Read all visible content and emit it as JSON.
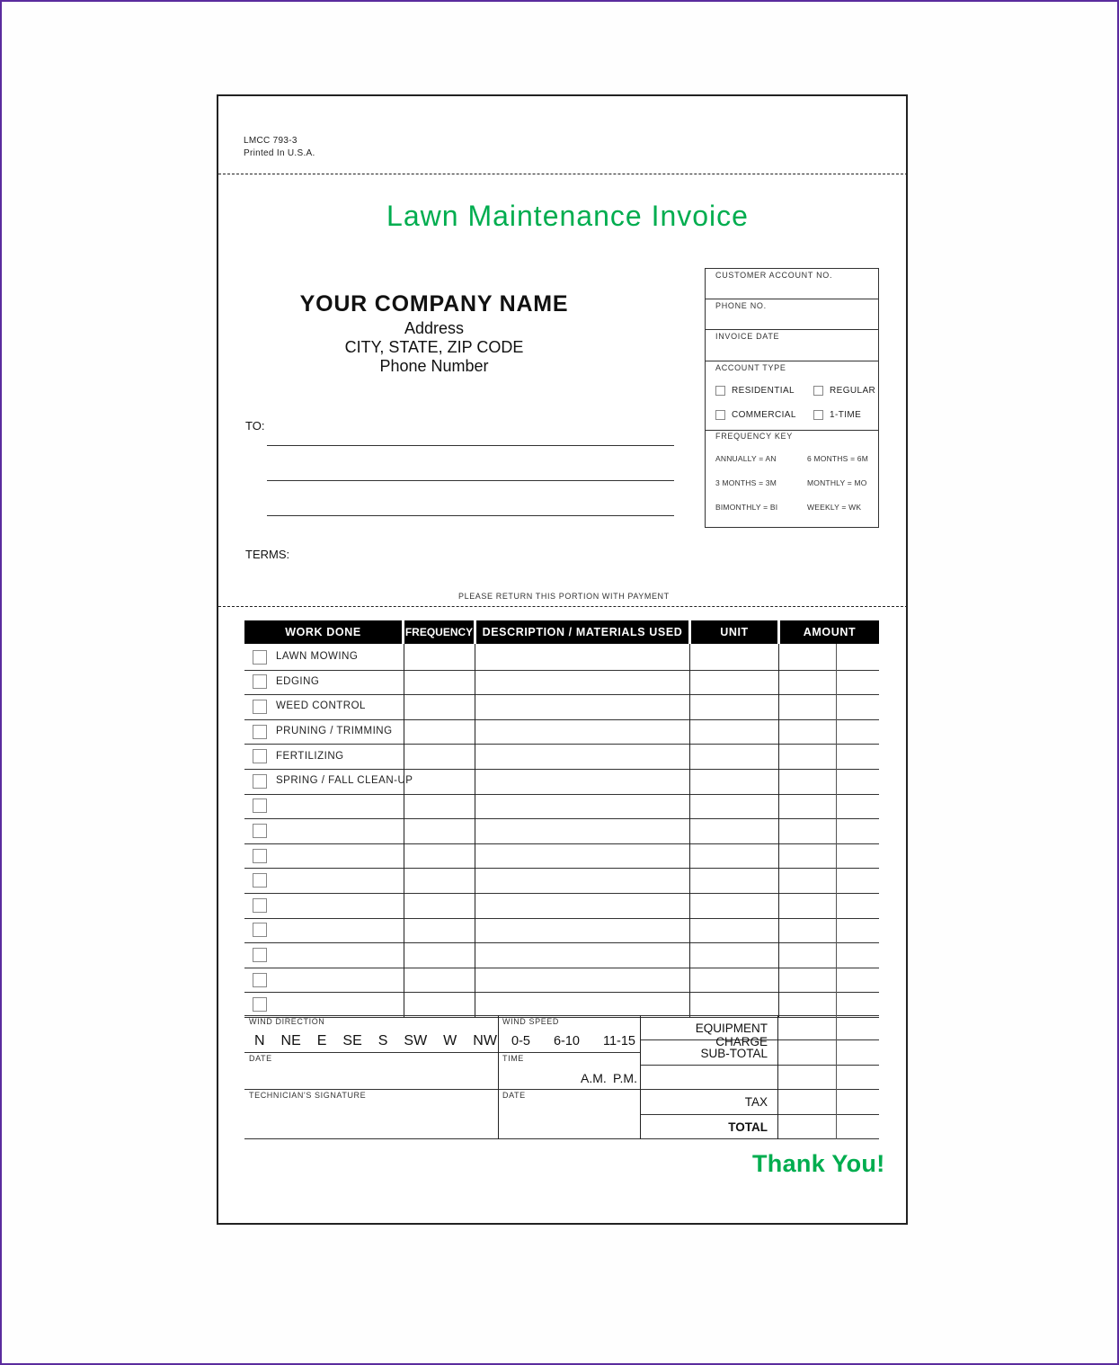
{
  "form": {
    "code": "LMCC 793-3",
    "printed": "Printed In U.S.A.",
    "title": "Lawn Maintenance Invoice",
    "accent_color": "#00ad4f",
    "frame_color": "#5b2c9e"
  },
  "company": {
    "name": "YOUR COMPANY NAME",
    "address": "Address",
    "city_state_zip": "CITY, STATE, ZIP CODE",
    "phone": "Phone Number"
  },
  "to_label": "TO:",
  "terms_label": "TERMS:",
  "return_note": "PLEASE RETURN THIS PORTION WITH PAYMENT",
  "info_box": {
    "customer_account": "CUSTOMER ACCOUNT NO.",
    "phone": "PHONE NO.",
    "invoice_date": "INVOICE DATE",
    "account_type": {
      "label": "ACCOUNT TYPE",
      "options": [
        "RESIDENTIAL",
        "REGULAR",
        "COMMERCIAL",
        "1-TIME"
      ]
    },
    "frequency_key": {
      "label": "FREQUENCY KEY",
      "items": [
        "ANNUALLY =  AN",
        "6 MONTHS =  6M",
        "3 MONTHS =  3M",
        "MONTHLY =  MO",
        "BIMONTHLY =  BI",
        "WEEKLY =  WK"
      ]
    }
  },
  "table": {
    "headers": [
      "WORK DONE",
      "FREQUENCY",
      "DESCRIPTION / MATERIALS USED",
      "UNIT",
      "AMOUNT"
    ],
    "rows": [
      "LAWN MOWING",
      "EDGING",
      "WEED CONTROL",
      "PRUNING / TRIMMING",
      "FERTILIZING",
      "SPRING / FALL CLEAN-UP",
      "",
      "",
      "",
      "",
      "",
      "",
      "",
      "",
      ""
    ]
  },
  "footer": {
    "wind_direction": {
      "label": "WIND DIRECTION",
      "options": [
        "N",
        "NE",
        "E",
        "SE",
        "S",
        "SW",
        "W",
        "NW"
      ]
    },
    "wind_speed": {
      "label": "WIND SPEED",
      "options": [
        "0-5",
        "6-10",
        "11-15"
      ]
    },
    "date_label": "DATE",
    "time_label": "TIME",
    "am": "A.M.",
    "pm": "P.M.",
    "technician_signature": "TECHNICIAN'S SIGNATURE",
    "date2_label": "DATE",
    "summary": {
      "equipment_charge": "EQUIPMENT CHARGE",
      "subtotal": "SUB-TOTAL",
      "tax": "TAX",
      "total": "TOTAL"
    },
    "thank_you": "Thank You!"
  }
}
